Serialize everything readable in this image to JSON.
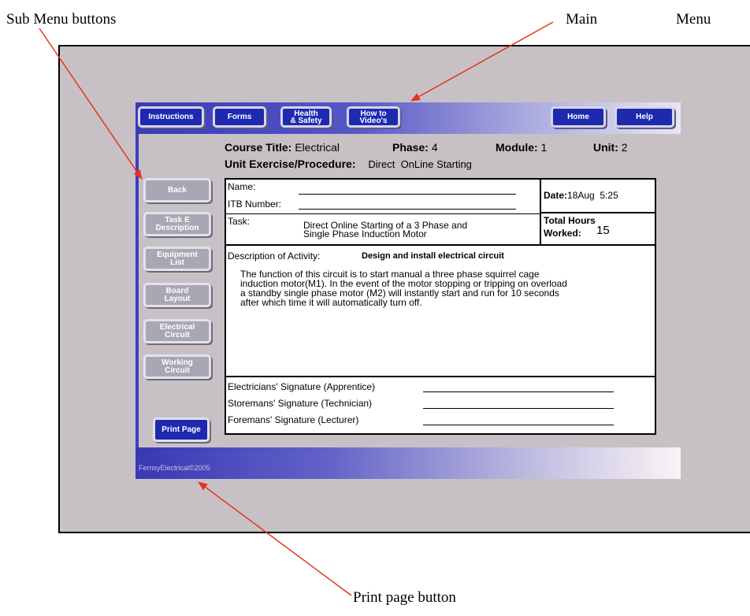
{
  "annotations": {
    "sub_menu": "Sub Menu buttons",
    "main": "Main",
    "menu": "Menu",
    "print_page": "Print page button"
  },
  "arrow_color": "#e8321e",
  "main_menu": {
    "instructions": "Instructions",
    "forms": "Forms",
    "health_1": "Health",
    "health_2": "& Safety",
    "video_1": "How to",
    "video_2": "Video's",
    "home": "Home",
    "help": "Help"
  },
  "header": {
    "course_label": "Course Title:",
    "course_value": "Electrical",
    "phase_label": "Phase:",
    "phase_value": "4",
    "module_label": "Module:",
    "module_value": "1",
    "unit_label": "Unit:",
    "unit_value": "2",
    "exercise_label": "Unit Exercise/Procedure:",
    "exercise_value": "Direct  OnLine Starting"
  },
  "sub_menu": {
    "back": "Back",
    "task_1": "Task E",
    "task_2": "Description",
    "equip_1": "Equipment",
    "equip_2": "List",
    "board_1": "Board",
    "board_2": "Layout",
    "elec_1": "Electrical",
    "elec_2": "Circuit",
    "work_1": "Working",
    "work_2": "Circuit",
    "print": "Print Page"
  },
  "form": {
    "name_label": "Name:",
    "itb_label": "ITB Number:",
    "task_label": "Task:",
    "task_line1": "Direct Online Starting of a 3 Phase and",
    "task_line2": "Single Phase Induction Motor",
    "date_label": "Date:",
    "date_value": "18Aug  5:25",
    "hours_label1": "Total Hours",
    "hours_label2": "Worked:",
    "hours_value": "15",
    "desc_label": "Description of Activity:",
    "desc_title": "Design and install electrical circuit",
    "desc_text": "The function of this circuit is to start manual a three phase squirrel cage\ninduction motor(M1). In the event of the motor stopping or tripping on overload\na standby single phase motor (M2) will instantly start and run for 10 seconds\nafter which time it will automatically turn off.",
    "sig_electrician": "Electricians' Signature (Apprentice)",
    "sig_storeman": "Storemans' Signature (Technician)",
    "sig_foreman": "Foremans' Signature (Lecturer)"
  },
  "footer": {
    "copyright": "FernsyElectrical©2005"
  }
}
